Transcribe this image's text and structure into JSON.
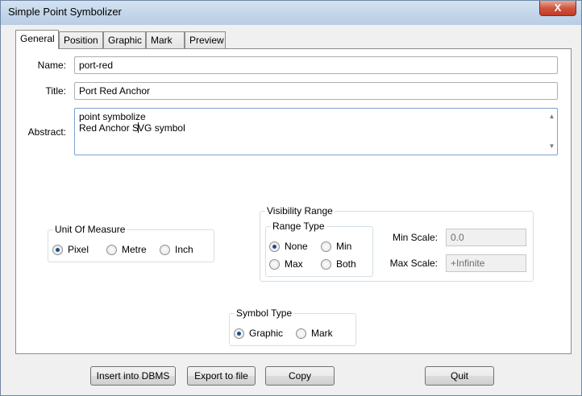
{
  "window": {
    "title": "Simple Point Symbolizer",
    "close_glyph": "X"
  },
  "tabs": [
    {
      "label": "General",
      "active": true
    },
    {
      "label": "Position"
    },
    {
      "label": "Graphic"
    },
    {
      "label": "Mark"
    },
    {
      "label": "Preview"
    }
  ],
  "general": {
    "name_label": "Name:",
    "name_value": "port-red",
    "title_label": "Title:",
    "title_value": "Port Red Anchor",
    "abstract_label": "Abstract:",
    "abstract_line1": "point symbolize",
    "abstract_line2a": "Red Anchor S",
    "abstract_line2b": "VG symbol"
  },
  "unit_of_measure": {
    "title": "Unit Of Measure",
    "options": [
      {
        "label": "Pixel",
        "checked": true
      },
      {
        "label": "Metre",
        "checked": false
      },
      {
        "label": "Inch",
        "checked": false
      }
    ]
  },
  "visibility_range": {
    "title": "Visibility Range",
    "range_type_title": "Range Type",
    "options": [
      {
        "label": "None",
        "checked": true
      },
      {
        "label": "Min",
        "checked": false
      },
      {
        "label": "Max",
        "checked": false
      },
      {
        "label": "Both",
        "checked": false
      }
    ],
    "min_scale_label": "Min Scale:",
    "min_scale_value": "0.0",
    "max_scale_label": "Max Scale:",
    "max_scale_value": "+Infinite"
  },
  "symbol_type": {
    "title": "Symbol Type",
    "options": [
      {
        "label": "Graphic",
        "checked": true
      },
      {
        "label": "Mark",
        "checked": false
      }
    ]
  },
  "buttons": {
    "insert": "Insert into DBMS",
    "export": "Export to file",
    "copy": "Copy",
    "quit": "Quit"
  }
}
